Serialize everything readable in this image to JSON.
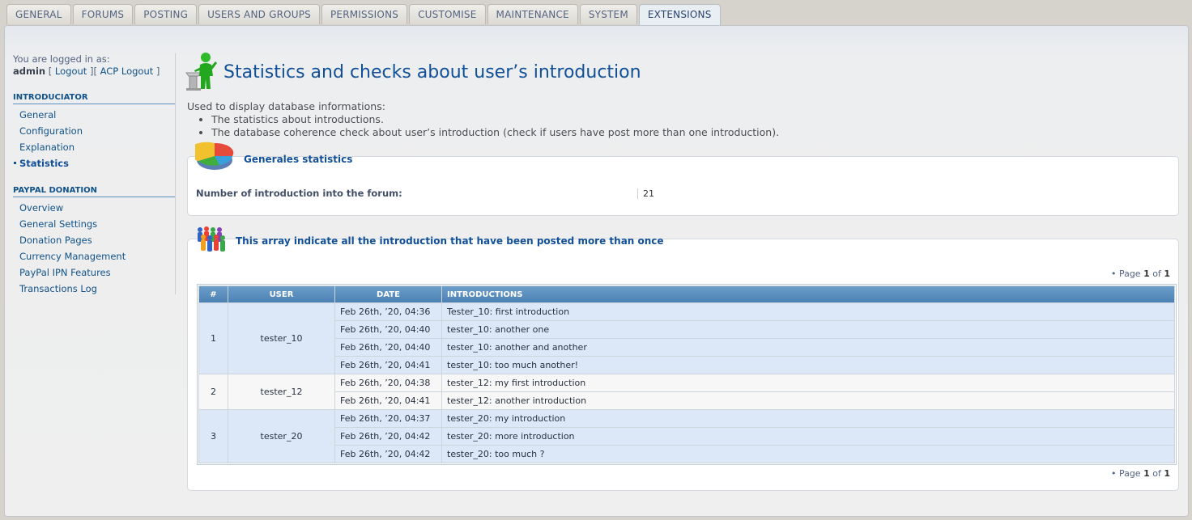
{
  "tabs": [
    {
      "label": "GENERAL"
    },
    {
      "label": "FORUMS"
    },
    {
      "label": "POSTING"
    },
    {
      "label": "USERS AND GROUPS"
    },
    {
      "label": "PERMISSIONS"
    },
    {
      "label": "CUSTOMISE"
    },
    {
      "label": "MAINTENANCE"
    },
    {
      "label": "SYSTEM"
    },
    {
      "label": "EXTENSIONS"
    }
  ],
  "login": {
    "text": "You are logged in as:",
    "user": "admin",
    "logout": "Logout",
    "acp_logout": "ACP Logout"
  },
  "menu": {
    "sections": [
      {
        "title": "INTRODUCIATOR",
        "items": [
          "General",
          "Configuration",
          "Explanation",
          "Statistics"
        ]
      },
      {
        "title": "PAYPAL DONATION",
        "items": [
          "Overview",
          "General Settings",
          "Donation Pages",
          "Currency Management",
          "PayPal IPN Features",
          "Transactions Log"
        ]
      }
    ],
    "active": "Statistics"
  },
  "page": {
    "title": "Statistics and checks about user’s introduction",
    "desc_intro": "Used to display database informations:",
    "desc_items": [
      "The statistics about introductions.",
      "The database coherence check about user’s introduction (check if users have post more than one introduction)."
    ]
  },
  "stats": {
    "legend": "Generales statistics",
    "label": "Number of introduction into the forum:",
    "value": "21"
  },
  "dup": {
    "legend": "This array indicate all the introduction that have been posted more than once",
    "pager_prefix": "• Page",
    "page": "1",
    "of": "of",
    "total": "1",
    "columns": [
      "#",
      "USER",
      "DATE",
      "INTRODUCTIONS"
    ],
    "groups": [
      {
        "num": "1",
        "user": "tester_10",
        "rows": [
          {
            "date": "Feb 26th, ’20, 04:36",
            "intro": "Tester_10: first introduction"
          },
          {
            "date": "Feb 26th, ’20, 04:40",
            "intro": "tester_10: another one"
          },
          {
            "date": "Feb 26th, ’20, 04:40",
            "intro": "tester_10: another and another"
          },
          {
            "date": "Feb 26th, ’20, 04:41",
            "intro": "tester_10: too much another!"
          }
        ]
      },
      {
        "num": "2",
        "user": "tester_12",
        "rows": [
          {
            "date": "Feb 26th, ’20, 04:38",
            "intro": "tester_12: my first introduction"
          },
          {
            "date": "Feb 26th, ’20, 04:41",
            "intro": "tester_12: another introduction"
          }
        ]
      },
      {
        "num": "3",
        "user": "tester_20",
        "rows": [
          {
            "date": "Feb 26th, ’20, 04:37",
            "intro": "tester_20: my introduction"
          },
          {
            "date": "Feb 26th, ’20, 04:42",
            "intro": "tester_20: more introduction"
          },
          {
            "date": "Feb 26th, ’20, 04:42",
            "intro": "tester_20: too much ?"
          }
        ]
      }
    ]
  }
}
